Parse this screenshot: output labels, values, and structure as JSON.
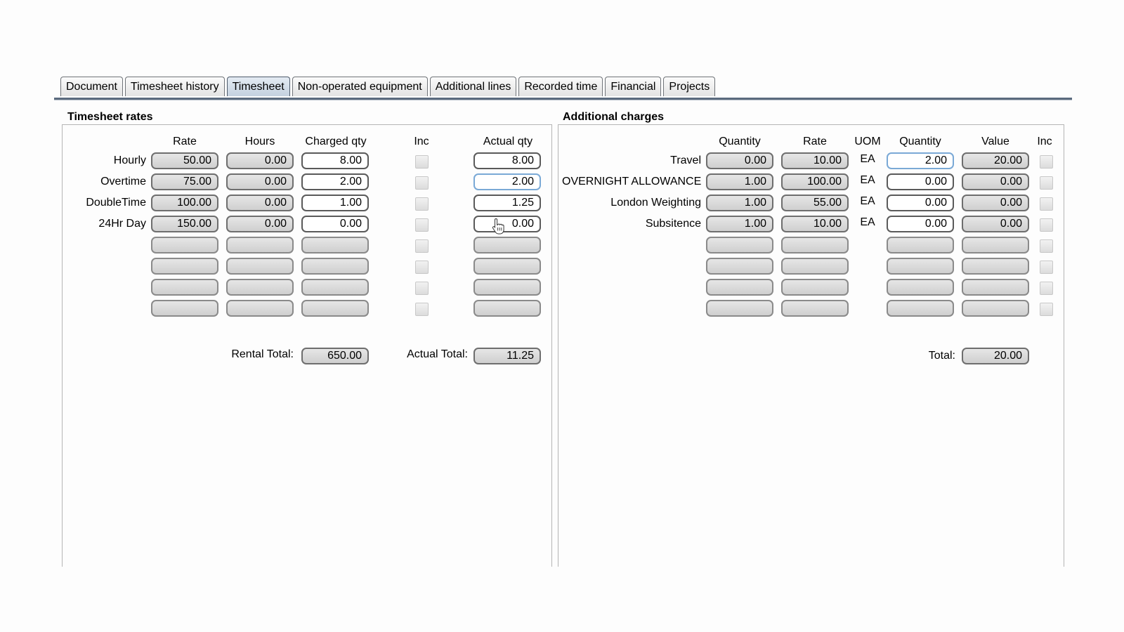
{
  "tabs": [
    {
      "label": "Document",
      "active": false
    },
    {
      "label": "Timesheet history",
      "active": false
    },
    {
      "label": "Timesheet",
      "active": true
    },
    {
      "label": "Non-operated equipment",
      "active": false
    },
    {
      "label": "Additional lines",
      "active": false
    },
    {
      "label": "Recorded time",
      "active": false
    },
    {
      "label": "Financial",
      "active": false
    },
    {
      "label": "Projects",
      "active": false
    }
  ],
  "timesheet_rates": {
    "title": "Timesheet rates",
    "headers": {
      "rate": "Rate",
      "hours": "Hours",
      "charged_qty": "Charged qty",
      "inc": "Inc",
      "actual_qty": "Actual qty"
    },
    "rows": [
      {
        "label": "Hourly",
        "rate": "50.00",
        "hours": "0.00",
        "charged_qty": "8.00",
        "actual_qty": "8.00"
      },
      {
        "label": "Overtime",
        "rate": "75.00",
        "hours": "0.00",
        "charged_qty": "2.00",
        "actual_qty": "2.00"
      },
      {
        "label": "DoubleTime",
        "rate": "100.00",
        "hours": "0.00",
        "charged_qty": "1.00",
        "actual_qty": "1.25"
      },
      {
        "label": "24Hr Day",
        "rate": "150.00",
        "hours": "0.00",
        "charged_qty": "0.00",
        "actual_qty": "0.00"
      }
    ],
    "rental_total_label": "Rental Total:",
    "rental_total": "650.00",
    "actual_total_label": "Actual Total:",
    "actual_total": "11.25"
  },
  "additional_charges": {
    "title": "Additional charges",
    "headers": {
      "quantity": "Quantity",
      "rate": "Rate",
      "uom": "UOM",
      "quantity2": "Quantity",
      "value": "Value",
      "inc": "Inc"
    },
    "rows": [
      {
        "label": "Travel",
        "quantity": "0.00",
        "rate": "10.00",
        "uom": "EA",
        "quantity2": "2.00",
        "value": "20.00"
      },
      {
        "label": "OVERNIGHT ALLOWANCE",
        "quantity": "1.00",
        "rate": "100.00",
        "uom": "EA",
        "quantity2": "0.00",
        "value": "0.00"
      },
      {
        "label": "London Weighting",
        "quantity": "1.00",
        "rate": "55.00",
        "uom": "EA",
        "quantity2": "0.00",
        "value": "0.00"
      },
      {
        "label": "Subsitence",
        "quantity": "1.00",
        "rate": "10.00",
        "uom": "EA",
        "quantity2": "0.00",
        "value": "0.00"
      }
    ],
    "total_label": "Total:",
    "total": "20.00"
  },
  "icons": {
    "cursor": "hand-pointer-cursor-icon"
  }
}
